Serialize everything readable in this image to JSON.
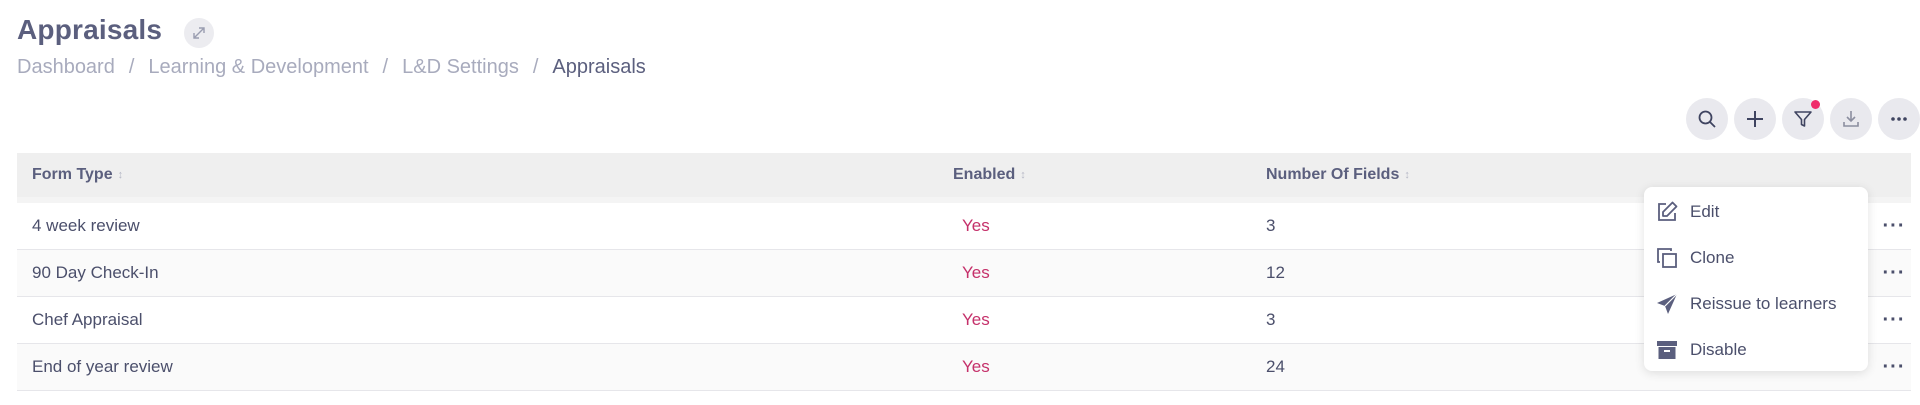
{
  "header": {
    "title": "Appraisals",
    "expand_icon": "expand-arrows-icon"
  },
  "breadcrumb": [
    {
      "label": "Dashboard"
    },
    {
      "label": "Learning & Development"
    },
    {
      "label": "L&D Settings"
    },
    {
      "label": "Appraisals"
    }
  ],
  "toolbar": {
    "buttons": [
      "search-icon",
      "plus-icon",
      "filter-icon",
      "download-icon",
      "more-icon"
    ],
    "filter_active_color": "#ef2d6b"
  },
  "table": {
    "columns": [
      "Form Type",
      "Enabled",
      "Number Of Fields"
    ],
    "rows": [
      {
        "form_type": "4 week review",
        "enabled": "Yes",
        "fields": "3"
      },
      {
        "form_type": "90 Day Check-In",
        "enabled": "Yes",
        "fields": "12"
      },
      {
        "form_type": "Chef Appraisal",
        "enabled": "Yes",
        "fields": "3"
      },
      {
        "form_type": "End of year review",
        "enabled": "Yes",
        "fields": "24"
      }
    ],
    "enabled_color": "#c5306a"
  },
  "row_menu": {
    "items": [
      {
        "label": "Edit",
        "icon": "edit-icon"
      },
      {
        "label": "Clone",
        "icon": "clone-icon"
      },
      {
        "label": "Reissue to learners",
        "icon": "send-icon"
      },
      {
        "label": "Disable",
        "icon": "archive-icon"
      }
    ]
  }
}
